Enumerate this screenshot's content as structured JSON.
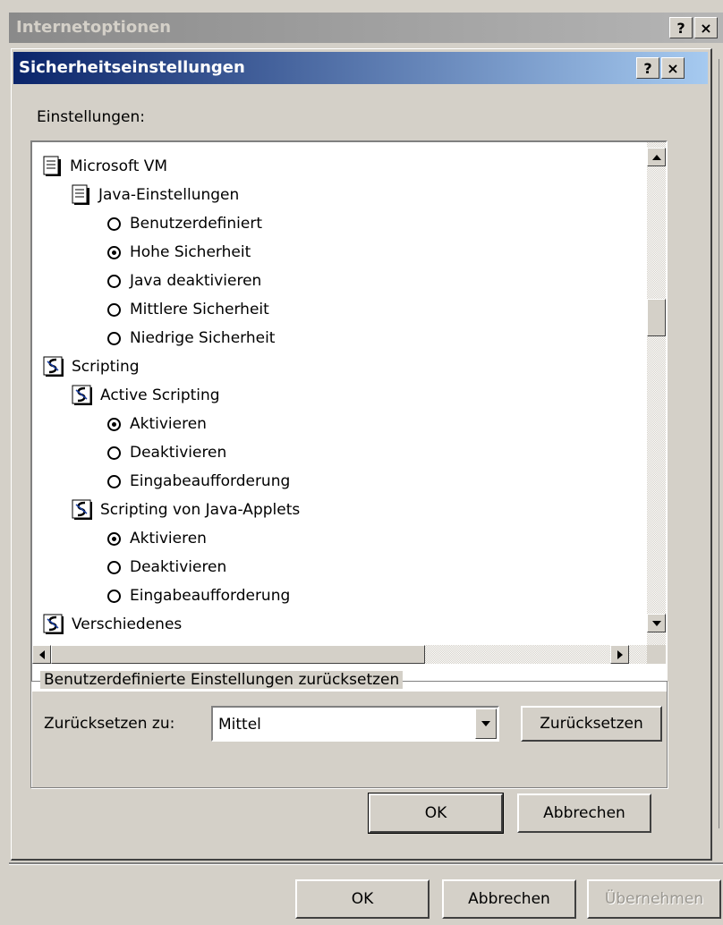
{
  "background_dialog": {
    "title": "Internetoptionen",
    "help_button": "?",
    "close_button": "×",
    "ok_label": "OK",
    "cancel_label": "Abbrechen",
    "apply_label": "Übernehmen"
  },
  "dialog": {
    "title": "Sicherheitseinstellungen",
    "help_button": "?",
    "close_button": "×",
    "settings_label": "Einstellungen:",
    "tree": [
      {
        "type": "doc",
        "level": 0,
        "label": "Microsoft VM"
      },
      {
        "type": "doc",
        "level": 1,
        "label": "Java-Einstellungen"
      },
      {
        "type": "radio",
        "level": 2,
        "label": "Benutzerdefiniert",
        "checked": false
      },
      {
        "type": "radio",
        "level": 2,
        "label": "Hohe Sicherheit",
        "checked": true
      },
      {
        "type": "radio",
        "level": 2,
        "label": "Java deaktivieren",
        "checked": false
      },
      {
        "type": "radio",
        "level": 2,
        "label": "Mittlere Sicherheit",
        "checked": false
      },
      {
        "type": "radio",
        "level": 2,
        "label": "Niedrige Sicherheit",
        "checked": false
      },
      {
        "type": "script",
        "level": 0,
        "label": "Scripting"
      },
      {
        "type": "script",
        "level": 1,
        "label": "Active Scripting"
      },
      {
        "type": "radio",
        "level": 2,
        "label": "Aktivieren",
        "checked": true
      },
      {
        "type": "radio",
        "level": 2,
        "label": "Deaktivieren",
        "checked": false
      },
      {
        "type": "radio",
        "level": 2,
        "label": "Eingabeaufforderung",
        "checked": false
      },
      {
        "type": "script",
        "level": 1,
        "label": "Scripting von Java-Applets"
      },
      {
        "type": "radio",
        "level": 2,
        "label": "Aktivieren",
        "checked": true
      },
      {
        "type": "radio",
        "level": 2,
        "label": "Deaktivieren",
        "checked": false
      },
      {
        "type": "radio",
        "level": 2,
        "label": "Eingabeaufforderung",
        "checked": false
      },
      {
        "type": "script",
        "level": 0,
        "label": "Verschiedenes"
      }
    ],
    "reset_group_label": "Benutzerdefinierte Einstellungen zurücksetzen",
    "reset_to_label": "Zurücksetzen zu:",
    "reset_to_value": "Mittel",
    "reset_button": "Zurücksetzen",
    "ok_label": "OK",
    "cancel_label": "Abbrechen"
  },
  "colors": {
    "titlebar_start": "#0a246a",
    "titlebar_end": "#a6caf0",
    "face": "#d4d0c8"
  }
}
